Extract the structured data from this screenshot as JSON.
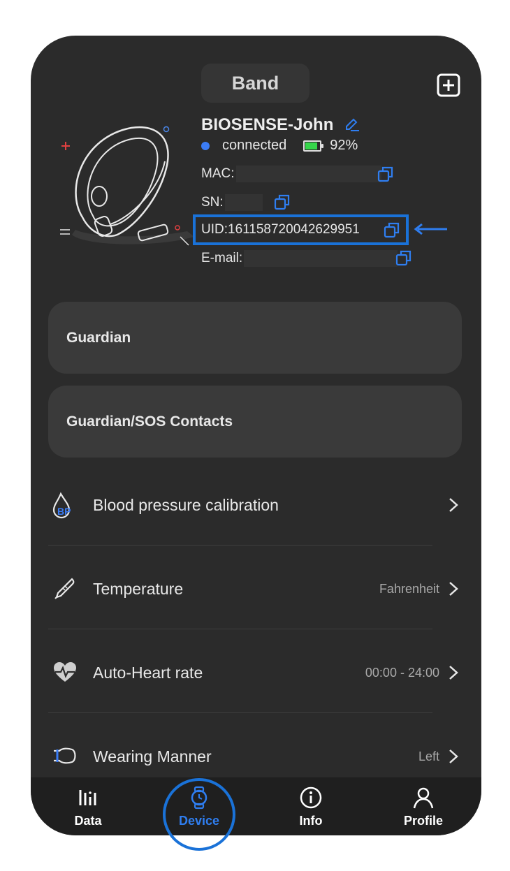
{
  "header": {
    "title": "Band"
  },
  "device": {
    "name": "BIOSENSE-John",
    "status": "connected",
    "battery": "92%",
    "battery_level": 0.92,
    "mac_label": "MAC:",
    "sn_label": "SN:",
    "uid": "UID:161158720042629951",
    "email_label": "E-mail:"
  },
  "cards": {
    "guardian": "Guardian",
    "contacts": "Guardian/SOS Contacts"
  },
  "settings": [
    {
      "label": "Blood pressure calibration",
      "value": "",
      "icon": "blood-pressure-icon"
    },
    {
      "label": "Temperature",
      "value": "Fahrenheit",
      "icon": "thermometer-icon"
    },
    {
      "label": "Auto-Heart rate",
      "value": "00:00 - 24:00",
      "icon": "heart-rate-icon"
    },
    {
      "label": "Wearing Manner",
      "value": "Left",
      "icon": "wrist-icon"
    }
  ],
  "tabs": [
    {
      "label": "Data",
      "icon": "bar-chart-icon"
    },
    {
      "label": "Device",
      "icon": "watch-icon"
    },
    {
      "label": "Info",
      "icon": "info-icon"
    },
    {
      "label": "Profile",
      "icon": "person-icon"
    }
  ],
  "colors": {
    "accent": "#2f7ef0",
    "highlight": "#1a72d8",
    "battery": "#35d64a"
  }
}
